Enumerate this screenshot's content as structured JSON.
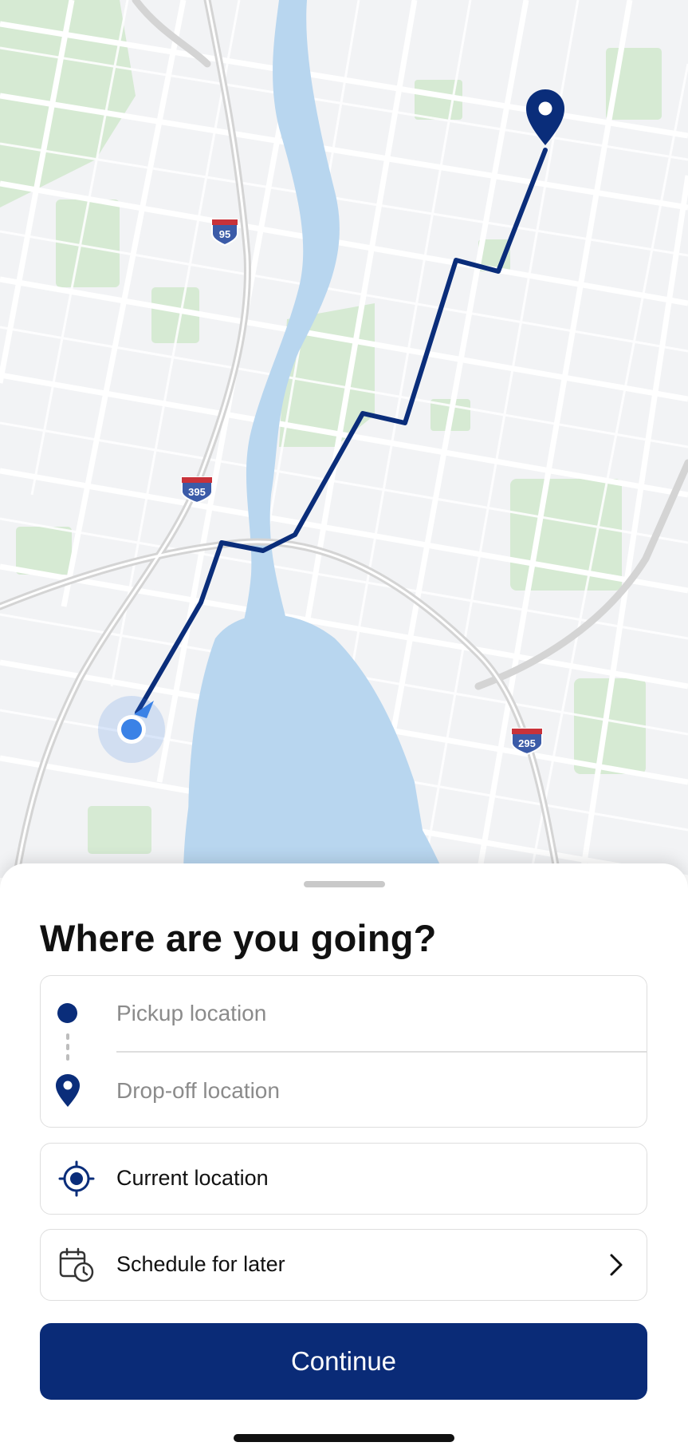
{
  "map": {
    "highway_shields": [
      "95",
      "395",
      "295"
    ],
    "colors": {
      "land": "#f2f3f5",
      "water": "#b8d6ef",
      "park": "#d6ead3",
      "road": "#ffffff",
      "highway": "#d8d8d8",
      "route": "#0a2d7a",
      "current_location": "#3b82e6"
    },
    "icons": [
      "destination-pin-icon",
      "current-location-dot-icon"
    ]
  },
  "sheet": {
    "title": "Where are you going?",
    "pickup_placeholder": "Pickup location",
    "dropoff_placeholder": "Drop-off location",
    "current_location_label": "Current location",
    "schedule_label": "Schedule for later",
    "continue_label": "Continue",
    "icons": [
      "pickup-dot-icon",
      "dropoff-pin-icon",
      "crosshair-icon",
      "calendar-clock-icon",
      "chevron-right-icon"
    ],
    "accent_color": "#0a2b77"
  }
}
